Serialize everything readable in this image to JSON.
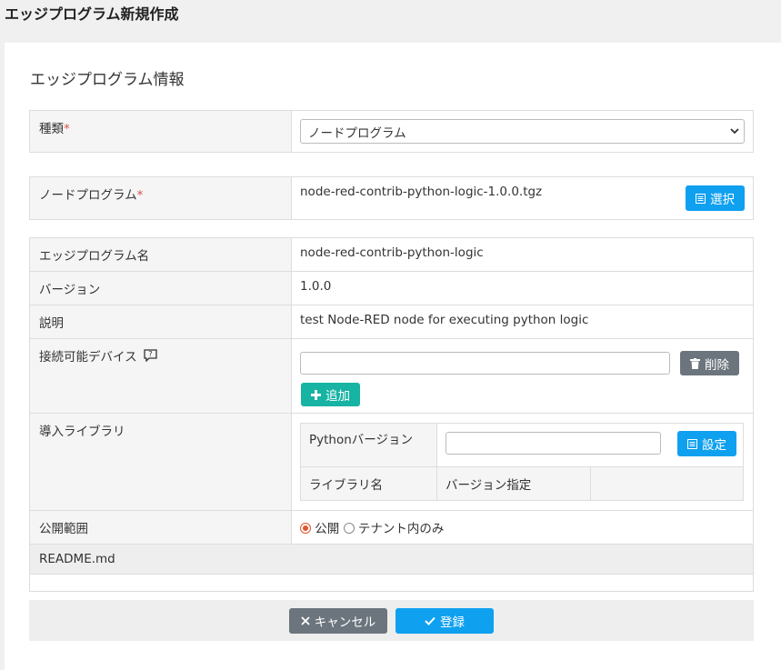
{
  "page": {
    "title": "エッジプログラム新規作成"
  },
  "section": {
    "title": "エッジプログラム情報"
  },
  "type_field": {
    "label": "種類",
    "required_mark": "*",
    "selected": "ノードプログラム"
  },
  "node_program": {
    "label": "ノードプログラム",
    "required_mark": "*",
    "file": "node-red-contrib-python-logic-1.0.0.tgz",
    "select_button": "選択"
  },
  "info": {
    "name_label": "エッジプログラム名",
    "name_value": "node-red-contrib-python-logic",
    "version_label": "バージョン",
    "version_value": "1.0.0",
    "desc_label": "説明",
    "desc_value": "test Node-RED node for executing python logic"
  },
  "devices": {
    "label": "接続可能デバイス",
    "delete_button": "削除",
    "add_button": "追加"
  },
  "libraries": {
    "label": "導入ライブラリ",
    "python_version_label": "Pythonバージョン",
    "set_button": "設定",
    "col_name": "ライブラリ名",
    "col_version": "バージョン指定"
  },
  "visibility": {
    "label": "公開範囲",
    "option_public": "公開",
    "option_tenant": "テナント内のみ",
    "selected": "公開"
  },
  "readme": {
    "label": "README.md"
  },
  "footer": {
    "cancel_button": "キャンセル",
    "register_button": "登録"
  },
  "colors": {
    "primary": "#0fa0f0",
    "secondary": "#6c757d",
    "success": "#17b3a3",
    "required": "#d9534f",
    "radio": "#e2552e"
  }
}
